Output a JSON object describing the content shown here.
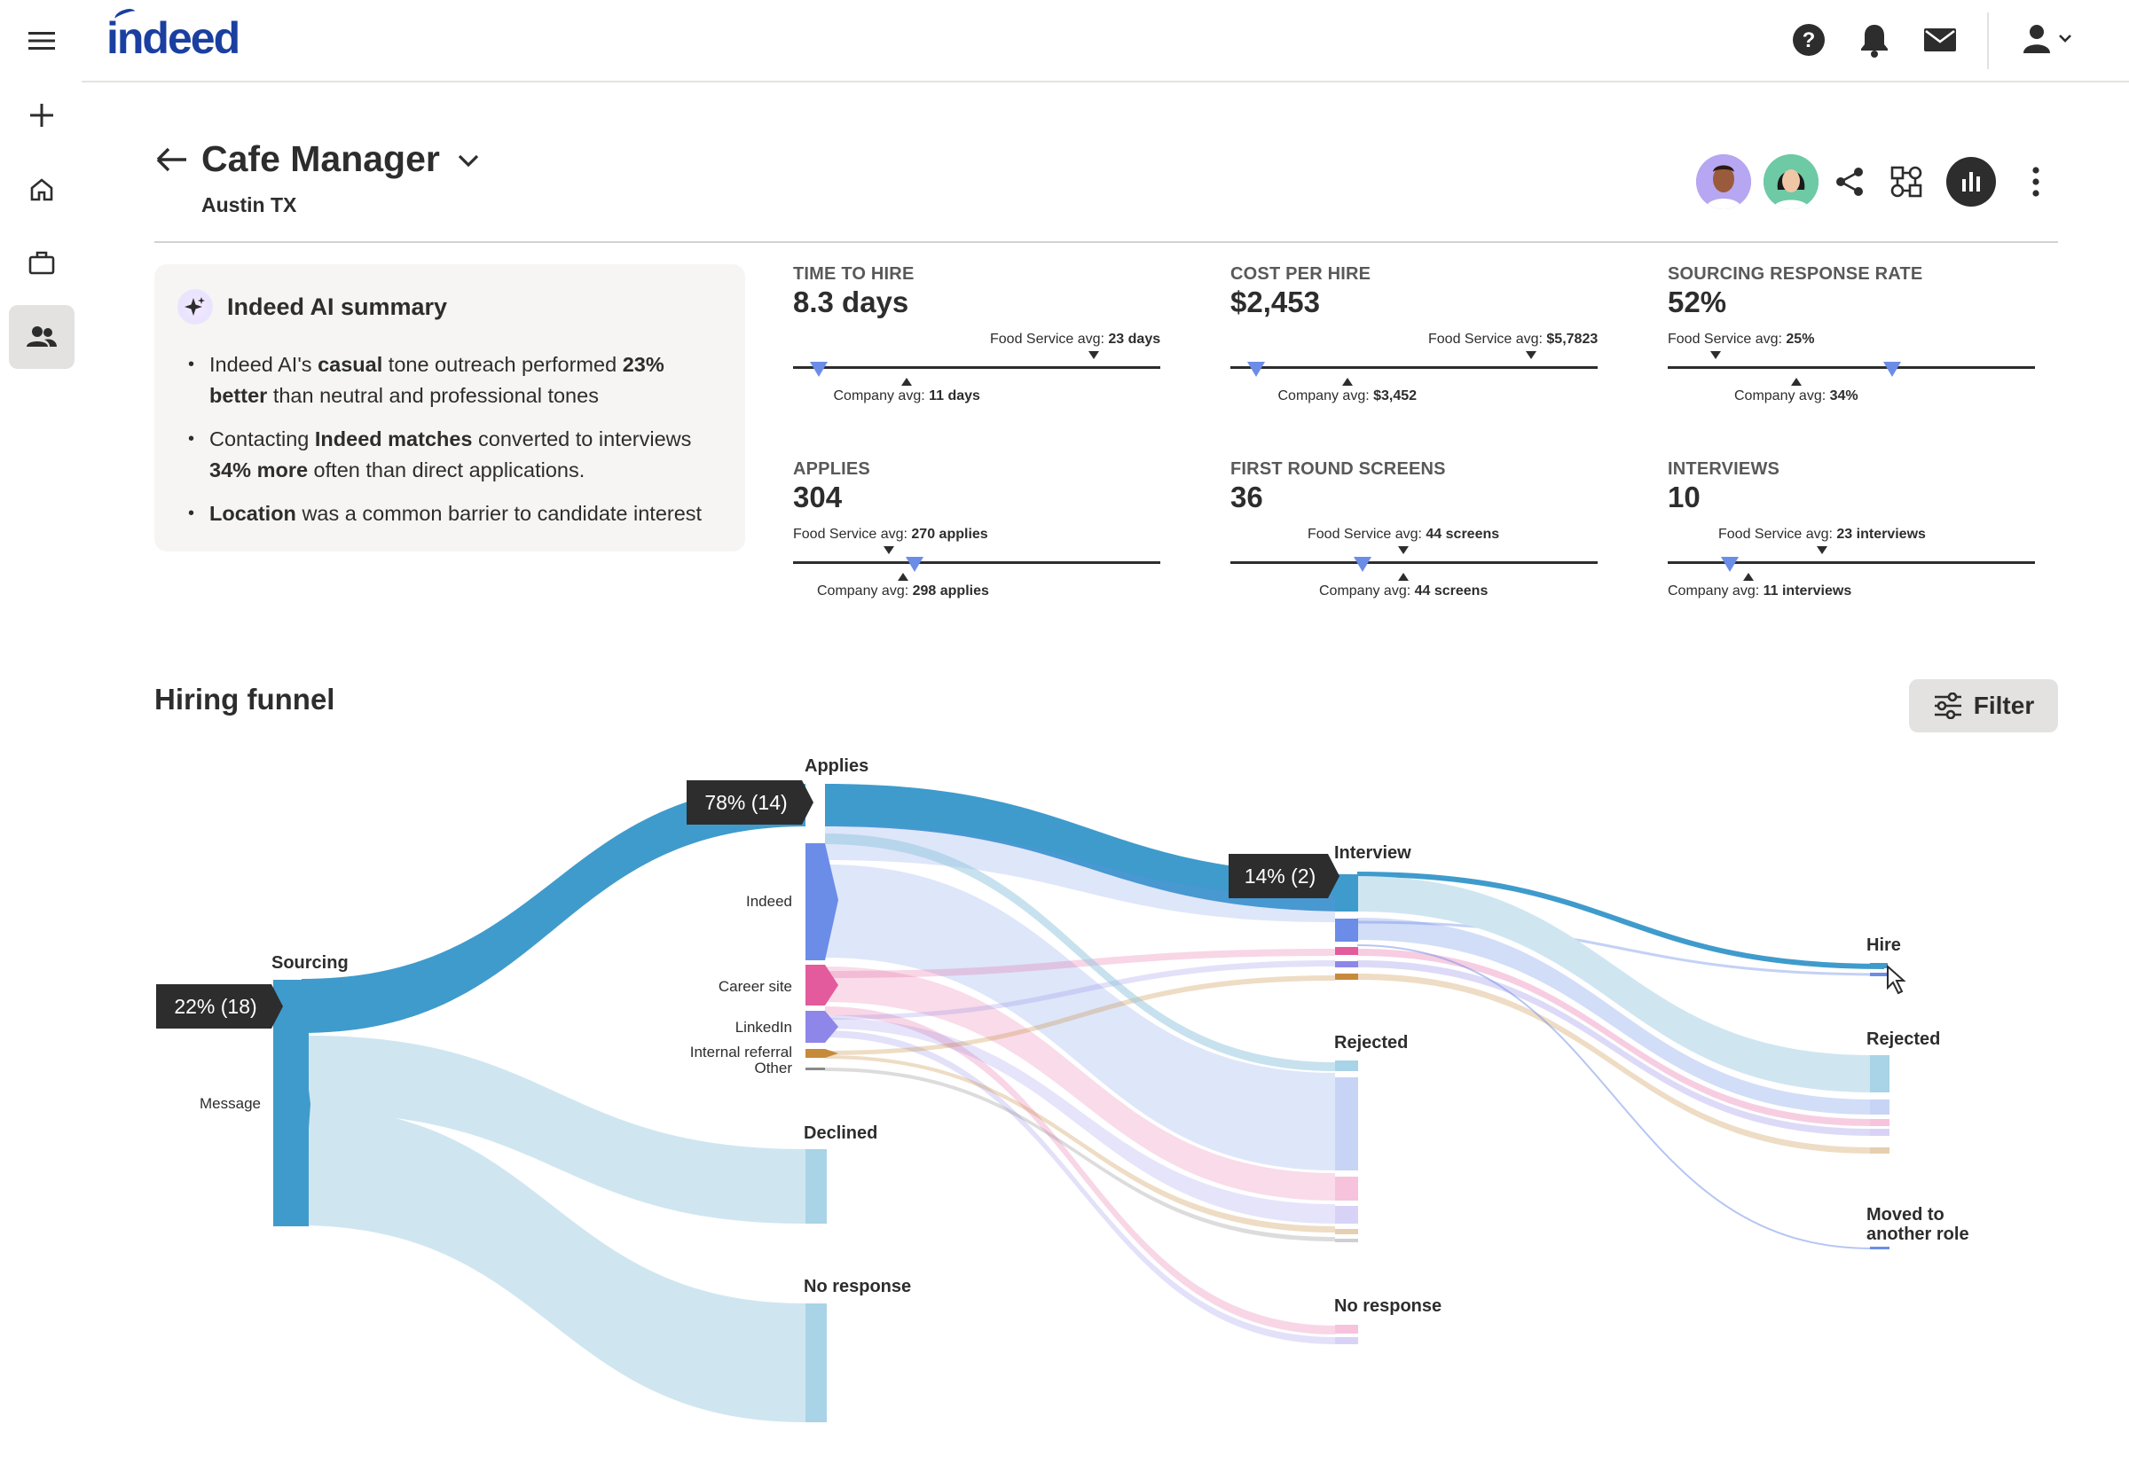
{
  "brand": {
    "logo_text": "indeed"
  },
  "job": {
    "title": "Cafe Manager",
    "location": "Austin TX"
  },
  "ai_summary": {
    "title": "Indeed AI summary",
    "bullets": [
      {
        "parts": [
          {
            "t": "Indeed AI's ",
            "b": false
          },
          {
            "t": "casual",
            "b": true
          },
          {
            "t": " tone outreach performed ",
            "b": false
          },
          {
            "t": "23% better",
            "b": true
          },
          {
            "t": " than neutral and professional tones",
            "b": false
          }
        ]
      },
      {
        "parts": [
          {
            "t": "Contacting ",
            "b": false
          },
          {
            "t": "Indeed matches",
            "b": true
          },
          {
            "t": " converted to interviews ",
            "b": false
          },
          {
            "t": "34% more",
            "b": true
          },
          {
            "t": " often than direct applications.",
            "b": false
          }
        ]
      },
      {
        "parts": [
          {
            "t": "Location",
            "b": true
          },
          {
            "t": " was a common barrier to candidate interest",
            "b": false
          }
        ]
      }
    ]
  },
  "metrics": [
    {
      "label": "TIME TO HIRE",
      "value": "8.3 days",
      "food_prefix": "Food Service avg: ",
      "food_value": "23 days",
      "comp_prefix": "Company avg: ",
      "comp_value": "11 days",
      "marker_pct": 0.07,
      "food_pct": 0.82,
      "comp_pct": 0.31
    },
    {
      "label": "COST PER HIRE",
      "value": "$2,453",
      "food_prefix": "Food Service avg: ",
      "food_value": "$5,7823",
      "comp_prefix": "Company avg: ",
      "comp_value": "$3,452",
      "marker_pct": 0.07,
      "food_pct": 0.82,
      "comp_pct": 0.32
    },
    {
      "label": "SOURCING RESPONSE RATE",
      "value": "52%",
      "food_prefix": "Food Service avg: ",
      "food_value": "25%",
      "comp_prefix": "Company avg: ",
      "comp_value": "34%",
      "marker_pct": 0.61,
      "food_pct": 0.13,
      "comp_pct": 0.35
    },
    {
      "label": "APPLIES",
      "value": "304",
      "food_prefix": "Food Service avg: ",
      "food_value": "270 applies",
      "comp_prefix": "Company avg: ",
      "comp_value": "298 applies",
      "marker_pct": 0.33,
      "food_pct": 0.26,
      "comp_pct": 0.3
    },
    {
      "label": "FIRST ROUND SCREENS",
      "value": "36",
      "food_prefix": "Food Service avg: ",
      "food_value": "44 screens",
      "comp_prefix": "Company avg: ",
      "comp_value": "44 screens",
      "marker_pct": 0.36,
      "food_pct": 0.47,
      "comp_pct": 0.47
    },
    {
      "label": "INTERVIEWS",
      "value": "10",
      "food_prefix": "Food Service avg: ",
      "food_value": "23 interviews",
      "comp_prefix": "Company avg: ",
      "comp_value": "11 interviews",
      "marker_pct": 0.17,
      "food_pct": 0.42,
      "comp_pct": 0.22
    }
  ],
  "funnel": {
    "title": "Hiring funnel",
    "filter_label": "Filter",
    "badges": {
      "sourcing": "22% (18)",
      "applies": "78% (14)",
      "interview": "14% (2)"
    },
    "stage_labels": {
      "sourcing": "Sourcing",
      "message": "Message",
      "applies": "Applies",
      "indeed": "Indeed",
      "career_site": "Career site",
      "linkedin": "LinkedIn",
      "internal_referral": "Internal referral",
      "other": "Other",
      "declined": "Declined",
      "no_response_1": "No response",
      "interview": "Interview",
      "rejected_1": "Rejected",
      "no_response_2": "No response",
      "hire": "Hire",
      "rejected_2": "Rejected",
      "moved_1": "Moved to",
      "moved_2": "another role"
    }
  },
  "colors": {
    "primary_flow": "#3f9bcc",
    "light_flow": "#cfe6f1",
    "indeed": "#6b8de8",
    "career": "#e35b9c",
    "linkedin": "#8e86e8",
    "referral": "#c68a3a",
    "other": "#8a8a8a",
    "brand": "#1a3fa0"
  }
}
